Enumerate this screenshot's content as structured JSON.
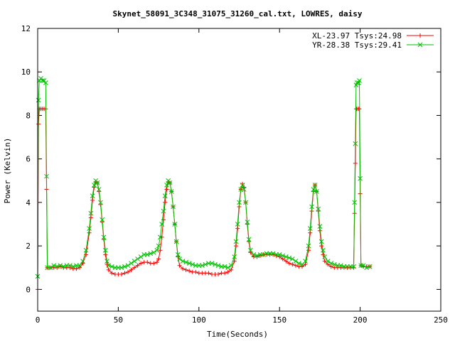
{
  "chart_data": {
    "type": "line",
    "title": "Skynet_58091_3C348_31075_31260_cal.txt, LOWRES, daisy",
    "xlabel": "Time(Seconds)",
    "ylabel": "Power (Kelvin)",
    "xlim": [
      0,
      250
    ],
    "ylim": [
      -1,
      12
    ],
    "xticks": [
      0,
      50,
      100,
      150,
      200,
      250
    ],
    "yticks": [
      0,
      2,
      4,
      6,
      8,
      10,
      12
    ],
    "grid": false,
    "legend_position": "top-right",
    "series": [
      {
        "name": "XL-23.97 Tsys:24.98",
        "color": "#ff0000",
        "marker": "plus",
        "points": [
          [
            0,
            0
          ],
          [
            0.5,
            7.6
          ],
          [
            1,
            8.3
          ],
          [
            2,
            8.3
          ],
          [
            3,
            8.3
          ],
          [
            4,
            8.3
          ],
          [
            5,
            8.3
          ],
          [
            5.5,
            4.6
          ],
          [
            6,
            1.0
          ],
          [
            8,
            1.0
          ],
          [
            10,
            1.0
          ],
          [
            12,
            1.0
          ],
          [
            14,
            1.05
          ],
          [
            16,
            1.0
          ],
          [
            18,
            1.0
          ],
          [
            20,
            1.0
          ],
          [
            22,
            0.95
          ],
          [
            24,
            0.95
          ],
          [
            26,
            1.0
          ],
          [
            28,
            1.2
          ],
          [
            30,
            1.6
          ],
          [
            32,
            2.6
          ],
          [
            33,
            3.3
          ],
          [
            34,
            4.1
          ],
          [
            35,
            4.7
          ],
          [
            36,
            4.95
          ],
          [
            37,
            4.9
          ],
          [
            38,
            4.5
          ],
          [
            39,
            3.9
          ],
          [
            40,
            3.1
          ],
          [
            41,
            2.3
          ],
          [
            42,
            1.6
          ],
          [
            43,
            1.15
          ],
          [
            44,
            0.9
          ],
          [
            46,
            0.75
          ],
          [
            48,
            0.7
          ],
          [
            50,
            0.7
          ],
          [
            52,
            0.7
          ],
          [
            54,
            0.75
          ],
          [
            56,
            0.8
          ],
          [
            58,
            0.9
          ],
          [
            60,
            1.0
          ],
          [
            62,
            1.1
          ],
          [
            64,
            1.2
          ],
          [
            66,
            1.25
          ],
          [
            68,
            1.25
          ],
          [
            70,
            1.2
          ],
          [
            72,
            1.2
          ],
          [
            74,
            1.25
          ],
          [
            75,
            1.4
          ],
          [
            76,
            1.8
          ],
          [
            77,
            2.4
          ],
          [
            78,
            3.2
          ],
          [
            79,
            4.0
          ],
          [
            80,
            4.6
          ],
          [
            81,
            4.95
          ],
          [
            82,
            4.9
          ],
          [
            83,
            4.5
          ],
          [
            84,
            3.8
          ],
          [
            85,
            3.0
          ],
          [
            86,
            2.2
          ],
          [
            87,
            1.5
          ],
          [
            88,
            1.1
          ],
          [
            90,
            0.95
          ],
          [
            92,
            0.9
          ],
          [
            94,
            0.85
          ],
          [
            96,
            0.8
          ],
          [
            98,
            0.8
          ],
          [
            100,
            0.75
          ],
          [
            102,
            0.75
          ],
          [
            104,
            0.75
          ],
          [
            106,
            0.75
          ],
          [
            108,
            0.7
          ],
          [
            110,
            0.7
          ],
          [
            112,
            0.7
          ],
          [
            114,
            0.75
          ],
          [
            116,
            0.75
          ],
          [
            118,
            0.8
          ],
          [
            120,
            0.9
          ],
          [
            122,
            1.3
          ],
          [
            123,
            2.0
          ],
          [
            124,
            2.8
          ],
          [
            125,
            3.8
          ],
          [
            126,
            4.6
          ],
          [
            127,
            4.85
          ],
          [
            128,
            4.7
          ],
          [
            129,
            4.0
          ],
          [
            130,
            3.0
          ],
          [
            131,
            2.2
          ],
          [
            132,
            1.7
          ],
          [
            134,
            1.5
          ],
          [
            136,
            1.5
          ],
          [
            138,
            1.55
          ],
          [
            140,
            1.6
          ],
          [
            142,
            1.6
          ],
          [
            144,
            1.6
          ],
          [
            146,
            1.6
          ],
          [
            148,
            1.55
          ],
          [
            150,
            1.5
          ],
          [
            152,
            1.4
          ],
          [
            154,
            1.3
          ],
          [
            156,
            1.2
          ],
          [
            158,
            1.15
          ],
          [
            160,
            1.1
          ],
          [
            162,
            1.05
          ],
          [
            164,
            1.05
          ],
          [
            166,
            1.15
          ],
          [
            168,
            1.8
          ],
          [
            169,
            2.6
          ],
          [
            170,
            3.6
          ],
          [
            171,
            4.5
          ],
          [
            172,
            4.8
          ],
          [
            173,
            4.5
          ],
          [
            174,
            3.6
          ],
          [
            175,
            2.7
          ],
          [
            176,
            2.0
          ],
          [
            177,
            1.6
          ],
          [
            178,
            1.3
          ],
          [
            180,
            1.15
          ],
          [
            182,
            1.05
          ],
          [
            184,
            1.0
          ],
          [
            186,
            1.0
          ],
          [
            188,
            1.0
          ],
          [
            190,
            1.0
          ],
          [
            192,
            1.0
          ],
          [
            194,
            1.0
          ],
          [
            196,
            1.0
          ],
          [
            196.5,
            3.5
          ],
          [
            197,
            5.8
          ],
          [
            197.5,
            8.3
          ],
          [
            198,
            8.3
          ],
          [
            199,
            8.3
          ],
          [
            199.5,
            8.3
          ],
          [
            200,
            4.4
          ],
          [
            200.5,
            1.1
          ],
          [
            202,
            1.05
          ],
          [
            204,
            1.05
          ],
          [
            206,
            1.05
          ]
        ]
      },
      {
        "name": "YR-28.38 Tsys:29.41",
        "color": "#00c000",
        "marker": "cross",
        "points": [
          [
            0,
            0.6
          ],
          [
            0.5,
            8.7
          ],
          [
            1,
            9.6
          ],
          [
            2,
            9.7
          ],
          [
            3,
            9.6
          ],
          [
            4,
            9.6
          ],
          [
            5,
            9.5
          ],
          [
            5.5,
            5.2
          ],
          [
            6,
            1.0
          ],
          [
            8,
            1.0
          ],
          [
            10,
            1.1
          ],
          [
            12,
            1.05
          ],
          [
            14,
            1.1
          ],
          [
            16,
            1.05
          ],
          [
            18,
            1.1
          ],
          [
            20,
            1.1
          ],
          [
            22,
            1.05
          ],
          [
            24,
            1.1
          ],
          [
            26,
            1.1
          ],
          [
            28,
            1.3
          ],
          [
            30,
            1.8
          ],
          [
            32,
            2.8
          ],
          [
            33,
            3.5
          ],
          [
            34,
            4.3
          ],
          [
            35,
            4.8
          ],
          [
            36,
            5.0
          ],
          [
            37,
            4.9
          ],
          [
            38,
            4.6
          ],
          [
            39,
            4.0
          ],
          [
            40,
            3.2
          ],
          [
            41,
            2.4
          ],
          [
            42,
            1.8
          ],
          [
            43,
            1.3
          ],
          [
            44,
            1.1
          ],
          [
            46,
            1.05
          ],
          [
            48,
            1.0
          ],
          [
            50,
            1.0
          ],
          [
            52,
            1.0
          ],
          [
            54,
            1.05
          ],
          [
            56,
            1.1
          ],
          [
            58,
            1.2
          ],
          [
            60,
            1.3
          ],
          [
            62,
            1.4
          ],
          [
            64,
            1.5
          ],
          [
            66,
            1.6
          ],
          [
            68,
            1.6
          ],
          [
            70,
            1.65
          ],
          [
            72,
            1.7
          ],
          [
            74,
            1.8
          ],
          [
            75,
            2.0
          ],
          [
            76,
            2.4
          ],
          [
            77,
            3.0
          ],
          [
            78,
            3.6
          ],
          [
            79,
            4.3
          ],
          [
            80,
            4.8
          ],
          [
            81,
            5.0
          ],
          [
            82,
            4.9
          ],
          [
            83,
            4.5
          ],
          [
            84,
            3.8
          ],
          [
            85,
            3.0
          ],
          [
            86,
            2.2
          ],
          [
            87,
            1.6
          ],
          [
            88,
            1.4
          ],
          [
            90,
            1.3
          ],
          [
            92,
            1.25
          ],
          [
            94,
            1.2
          ],
          [
            96,
            1.15
          ],
          [
            98,
            1.1
          ],
          [
            100,
            1.1
          ],
          [
            102,
            1.1
          ],
          [
            104,
            1.15
          ],
          [
            106,
            1.2
          ],
          [
            108,
            1.2
          ],
          [
            110,
            1.15
          ],
          [
            112,
            1.1
          ],
          [
            114,
            1.05
          ],
          [
            116,
            1.05
          ],
          [
            118,
            1.0
          ],
          [
            120,
            1.1
          ],
          [
            122,
            1.5
          ],
          [
            123,
            2.2
          ],
          [
            124,
            3.0
          ],
          [
            125,
            4.0
          ],
          [
            126,
            4.6
          ],
          [
            127,
            4.8
          ],
          [
            128,
            4.6
          ],
          [
            129,
            4.0
          ],
          [
            130,
            3.1
          ],
          [
            131,
            2.3
          ],
          [
            132,
            1.8
          ],
          [
            134,
            1.6
          ],
          [
            136,
            1.55
          ],
          [
            138,
            1.6
          ],
          [
            140,
            1.6
          ],
          [
            142,
            1.65
          ],
          [
            144,
            1.65
          ],
          [
            146,
            1.65
          ],
          [
            148,
            1.6
          ],
          [
            150,
            1.6
          ],
          [
            152,
            1.55
          ],
          [
            154,
            1.5
          ],
          [
            156,
            1.45
          ],
          [
            158,
            1.4
          ],
          [
            160,
            1.3
          ],
          [
            162,
            1.2
          ],
          [
            164,
            1.15
          ],
          [
            166,
            1.3
          ],
          [
            168,
            2.0
          ],
          [
            169,
            2.8
          ],
          [
            170,
            3.8
          ],
          [
            171,
            4.6
          ],
          [
            172,
            4.8
          ],
          [
            173,
            4.5
          ],
          [
            174,
            3.7
          ],
          [
            175,
            2.9
          ],
          [
            176,
            2.2
          ],
          [
            177,
            1.8
          ],
          [
            178,
            1.5
          ],
          [
            180,
            1.3
          ],
          [
            182,
            1.2
          ],
          [
            184,
            1.15
          ],
          [
            186,
            1.1
          ],
          [
            188,
            1.1
          ],
          [
            190,
            1.05
          ],
          [
            192,
            1.05
          ],
          [
            194,
            1.05
          ],
          [
            196,
            1.05
          ],
          [
            196.5,
            4.0
          ],
          [
            197,
            6.7
          ],
          [
            197.5,
            9.4
          ],
          [
            198,
            9.5
          ],
          [
            199,
            9.5
          ],
          [
            199.5,
            9.6
          ],
          [
            200,
            5.1
          ],
          [
            200.5,
            1.1
          ],
          [
            202,
            1.1
          ],
          [
            204,
            1.0
          ],
          [
            206,
            1.05
          ]
        ]
      }
    ]
  },
  "colors": {
    "axis": "#000000",
    "background": "#ffffff"
  }
}
